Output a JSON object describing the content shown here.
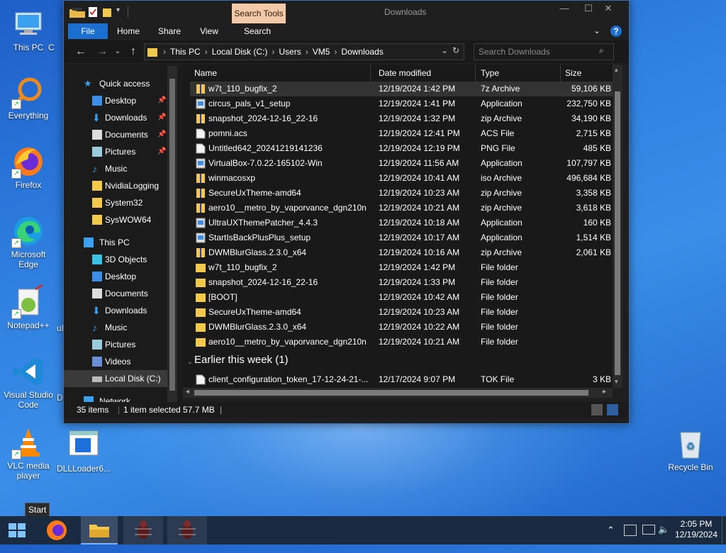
{
  "desktop": {
    "icons": [
      {
        "label": "This PC"
      },
      {
        "label": "Everything"
      },
      {
        "label": "Firefox"
      },
      {
        "label": "Microsoft Edge"
      },
      {
        "label": "Notepad++"
      },
      {
        "label": "Visual Studio Code"
      },
      {
        "label": "VLC media player"
      },
      {
        "label": "DLLLoader6..."
      },
      {
        "label": "Recycle Bin"
      }
    ],
    "partial_labels": [
      "C",
      "uD",
      "DL"
    ]
  },
  "window": {
    "title": "Downloads",
    "contextual_tab": "Search Tools",
    "controls": {
      "minimize": "—",
      "maximize": "☐",
      "close": "✕"
    },
    "ribbon_tabs": [
      "File",
      "Home",
      "Share",
      "View",
      "Search"
    ],
    "address": {
      "crumbs": [
        "This PC",
        "Local Disk (C:)",
        "Users",
        "VM5",
        "Downloads"
      ]
    },
    "search_placeholder": "Search Downloads",
    "nav_pane": [
      {
        "label": "Quick access"
      },
      {
        "label": "Desktop",
        "pinned": true
      },
      {
        "label": "Downloads",
        "pinned": true
      },
      {
        "label": "Documents",
        "pinned": true
      },
      {
        "label": "Pictures",
        "pinned": true
      },
      {
        "label": "Music"
      },
      {
        "label": "NvidiaLogging"
      },
      {
        "label": "System32"
      },
      {
        "label": "SysWOW64"
      },
      {
        "label": "This PC"
      },
      {
        "label": "3D Objects"
      },
      {
        "label": "Desktop"
      },
      {
        "label": "Documents"
      },
      {
        "label": "Downloads"
      },
      {
        "label": "Music"
      },
      {
        "label": "Pictures"
      },
      {
        "label": "Videos"
      },
      {
        "label": "Local Disk (C:)"
      },
      {
        "label": "Network"
      }
    ],
    "columns": [
      "Name",
      "Date modified",
      "Type",
      "Size"
    ],
    "files": [
      {
        "name": "w7t_110_bugfix_2",
        "date": "12/19/2024 1:42 PM",
        "type": "7z Archive",
        "size": "59,106 KB"
      },
      {
        "name": "circus_pals_v1_setup",
        "date": "12/19/2024 1:41 PM",
        "type": "Application",
        "size": "232,750 KB"
      },
      {
        "name": "snapshot_2024-12-16_22-16",
        "date": "12/19/2024 1:32 PM",
        "type": "zip Archive",
        "size": "34,190 KB"
      },
      {
        "name": "pomni.acs",
        "date": "12/19/2024 12:41 PM",
        "type": "ACS File",
        "size": "2,715 KB"
      },
      {
        "name": "Untitled642_20241219141236",
        "date": "12/19/2024 12:19 PM",
        "type": "PNG File",
        "size": "485 KB"
      },
      {
        "name": "VirtualBox-7.0.22-165102-Win",
        "date": "12/19/2024 11:56 AM",
        "type": "Application",
        "size": "107,797 KB"
      },
      {
        "name": "winmacosxp",
        "date": "12/19/2024 10:41 AM",
        "type": "iso Archive",
        "size": "496,684 KB"
      },
      {
        "name": "SecureUxTheme-amd64",
        "date": "12/19/2024 10:23 AM",
        "type": "zip Archive",
        "size": "3,358 KB"
      },
      {
        "name": "aero10__metro_by_vaporvance_dgn210n",
        "date": "12/19/2024 10:21 AM",
        "type": "zip Archive",
        "size": "3,618 KB"
      },
      {
        "name": "UltraUXThemePatcher_4.4.3",
        "date": "12/19/2024 10:18 AM",
        "type": "Application",
        "size": "160 KB"
      },
      {
        "name": "StartIsBackPlusPlus_setup",
        "date": "12/19/2024 10:17 AM",
        "type": "Application",
        "size": "1,514 KB"
      },
      {
        "name": "DWMBlurGlass.2.3.0_x64",
        "date": "12/19/2024 10:16 AM",
        "type": "zip Archive",
        "size": "2,061 KB"
      },
      {
        "name": "w7t_110_bugfix_2",
        "date": "12/19/2024 1:42 PM",
        "type": "File folder",
        "size": ""
      },
      {
        "name": "snapshot_2024-12-16_22-16",
        "date": "12/19/2024 1:33 PM",
        "type": "File folder",
        "size": ""
      },
      {
        "name": "[BOOT]",
        "date": "12/19/2024 10:42 AM",
        "type": "File folder",
        "size": ""
      },
      {
        "name": "SecureUxTheme-amd64",
        "date": "12/19/2024 10:23 AM",
        "type": "File folder",
        "size": ""
      },
      {
        "name": "DWMBlurGlass.2.3.0_x64",
        "date": "12/19/2024 10:22 AM",
        "type": "File folder",
        "size": ""
      },
      {
        "name": "aero10__metro_by_vaporvance_dgn210n",
        "date": "12/19/2024 10:21 AM",
        "type": "File folder",
        "size": ""
      }
    ],
    "group_earlier": "Earlier this week (1)",
    "earlier_files": [
      {
        "name": "client_configuration_token_17-12-24-21-...",
        "date": "12/17/2024 9:07 PM",
        "type": "TOK File",
        "size": "3 KB"
      }
    ],
    "status": {
      "count": "35 items",
      "selection": "1 item selected  57.7 MB"
    }
  },
  "taskbar": {
    "tooltip": "Start",
    "clock_time": "2:05 PM",
    "clock_date": "12/19/2024"
  },
  "colors": {
    "accent": "#1a6fd0",
    "window_bg": "#191919",
    "folder": "#f2c94c"
  }
}
